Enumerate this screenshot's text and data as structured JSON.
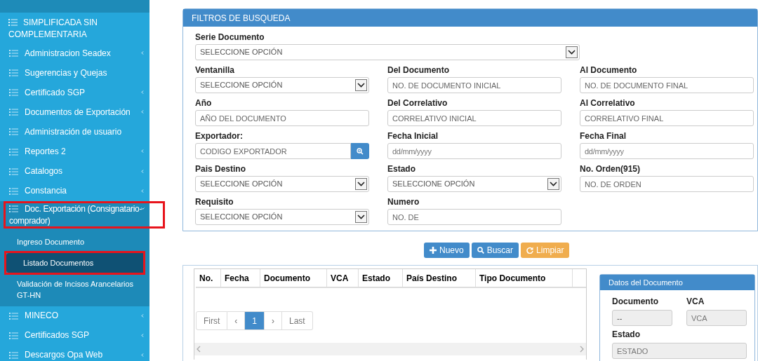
{
  "sidebar": {
    "items": [
      {
        "label": "SIMPLIFICADA SIN COMPLEMENTARIA",
        "kind": "header"
      },
      {
        "label": "Administracion Seadex",
        "kind": "item",
        "has_children": true,
        "expanded": false,
        "highlighted": false
      },
      {
        "label": "Sugerencias y Quejas",
        "kind": "item",
        "has_children": false,
        "expanded": false,
        "highlighted": false
      },
      {
        "label": "Certificado SGP",
        "kind": "item",
        "has_children": true,
        "expanded": false,
        "highlighted": false
      },
      {
        "label": "Documentos de Exportación",
        "kind": "item",
        "has_children": true,
        "expanded": false,
        "highlighted": false
      },
      {
        "label": "Administración de usuario",
        "kind": "item",
        "has_children": false,
        "expanded": false,
        "highlighted": false
      },
      {
        "label": "Reportes 2",
        "kind": "item",
        "has_children": true,
        "expanded": false,
        "highlighted": false
      },
      {
        "label": "Catalogos",
        "kind": "item",
        "has_children": true,
        "expanded": false,
        "highlighted": false
      },
      {
        "label": "Constancia",
        "kind": "item",
        "has_children": true,
        "expanded": false,
        "highlighted": false
      },
      {
        "label": "Doc. Exportación (Consignatario-comprador)",
        "kind": "item",
        "has_children": true,
        "expanded": true,
        "highlighted": true,
        "children": [
          {
            "label": "Ingreso Documento",
            "selected": false,
            "highlighted": false
          },
          {
            "label": "Listado Documentos",
            "selected": true,
            "highlighted": true
          },
          {
            "label": "Validación de Incisos Arancelarios GT-HN",
            "selected": false,
            "highlighted": false
          }
        ]
      },
      {
        "label": "MINECO",
        "kind": "item",
        "has_children": true,
        "expanded": false,
        "highlighted": false
      },
      {
        "label": "Certificados SGP",
        "kind": "item",
        "has_children": true,
        "expanded": false,
        "highlighted": false
      },
      {
        "label": "Descargos Opa Web",
        "kind": "item",
        "has_children": true,
        "expanded": false,
        "highlighted": false
      }
    ]
  },
  "filters": {
    "title": "FILTROS DE BUSQUEDA",
    "fields": [
      {
        "label": "Serie Documento",
        "kind": "select",
        "value": "SELECCIONE OPCIÓN",
        "wide": true
      },
      {
        "label": "Ventanilla",
        "kind": "select",
        "value": "SELECCIONE OPCIÓN",
        "wide": false
      },
      {
        "label": "Del Documento",
        "kind": "text",
        "placeholder": "NO. DE DOCUMENTO INICIAL",
        "wide": false
      },
      {
        "label": "Al Documento",
        "kind": "text",
        "placeholder": "NO. DE DOCUMENTO FINAL",
        "wide": false
      },
      {
        "label": "Año",
        "kind": "text",
        "placeholder": "AÑO DEL DOCUMENTO",
        "wide": false
      },
      {
        "label": "Del Correlativo",
        "kind": "text",
        "placeholder": "CORRELATIVO INICIAL",
        "wide": false
      },
      {
        "label": "Al Correlativo",
        "kind": "text",
        "placeholder": "CORRELATIVO FINAL",
        "wide": false
      },
      {
        "label": "Exportador:",
        "kind": "search",
        "placeholder": "CODIGO EXPORTADOR",
        "wide": false
      },
      {
        "label": "Fecha Inicial",
        "kind": "date",
        "placeholder": "dd/mm/yyyy",
        "wide": false
      },
      {
        "label": "Fecha Final",
        "kind": "date",
        "placeholder": "dd/mm/yyyy",
        "wide": false
      },
      {
        "label": "Pais Destino",
        "kind": "select",
        "value": "SELECCIONE OPCIÓN",
        "wide": false
      },
      {
        "label": "Estado",
        "kind": "select",
        "value": "SELECCIONE OPCIÓN",
        "wide": false
      },
      {
        "label": "No. Orden(915)",
        "kind": "text",
        "placeholder": "NO. DE ORDEN",
        "wide": false
      },
      {
        "label": "Requisito",
        "kind": "select",
        "value": "SELECCIONE OPCIÓN",
        "wide": false
      },
      {
        "label": "Numero",
        "kind": "text",
        "placeholder": "NO. DE",
        "wide": false
      }
    ]
  },
  "actions": [
    {
      "label": "Nuevo",
      "kind": "new"
    },
    {
      "label": "Buscar",
      "kind": "search"
    },
    {
      "label": "Limpiar",
      "kind": "clear"
    }
  ],
  "table": {
    "columns": [
      "No.",
      "Fecha",
      "Documento",
      "VCA",
      "Estado",
      "País Destino",
      "Tipo Documento"
    ],
    "pagination": [
      {
        "label": "First",
        "selected": false
      },
      {
        "label": "‹",
        "selected": false
      },
      {
        "label": "1",
        "selected": true
      },
      {
        "label": "›",
        "selected": false
      },
      {
        "label": "Last",
        "selected": false
      }
    ]
  },
  "details": {
    "title": "Datos del Documento",
    "fields": [
      {
        "label": "Documento",
        "value": "--",
        "wide": false
      },
      {
        "label": "VCA",
        "placeholder": "VCA",
        "wide": false
      },
      {
        "label": "Estado",
        "placeholder": "ESTADO",
        "wide": true
      }
    ]
  }
}
